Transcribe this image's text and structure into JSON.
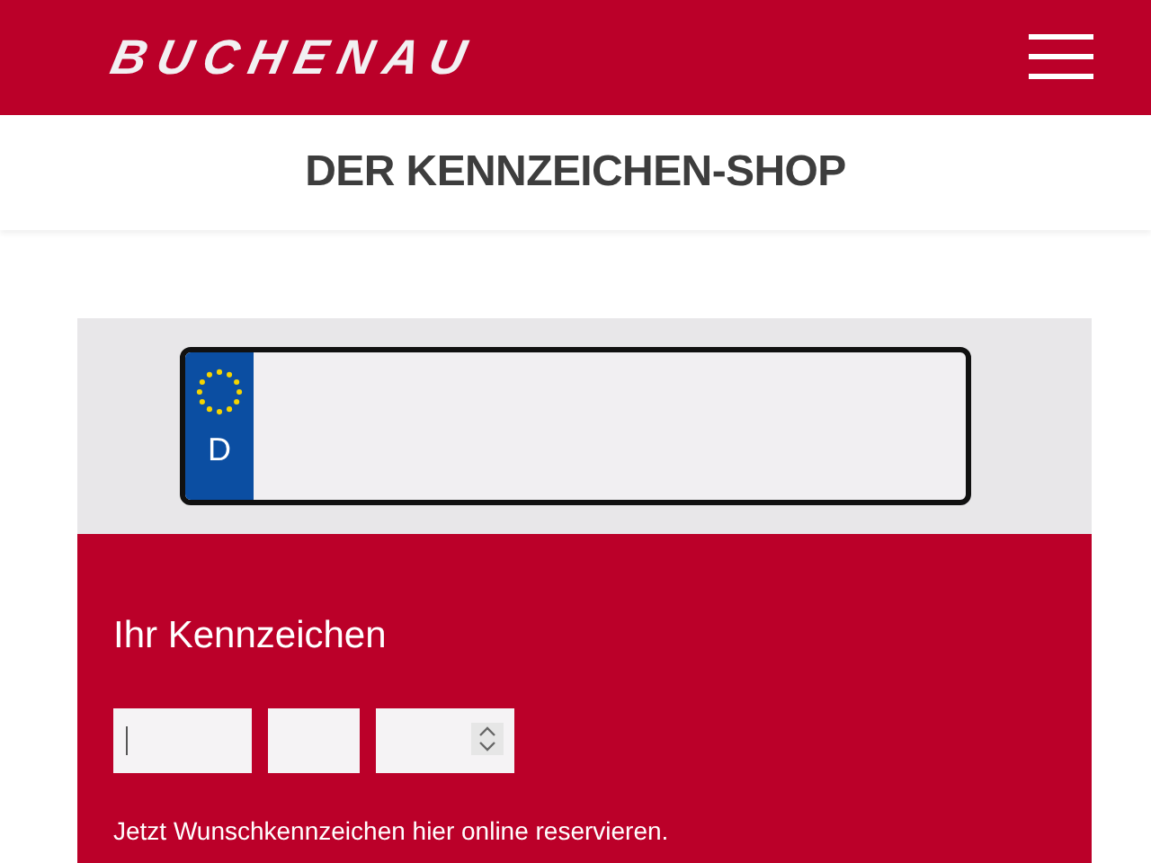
{
  "header": {
    "logo": "BUCHENAU"
  },
  "page_title": "DER KENNZEICHEN-SHOP",
  "plate": {
    "country": "D"
  },
  "form": {
    "heading": "Ihr Kennzeichen",
    "fields": [
      {
        "kind": "text",
        "focused": true
      },
      {
        "kind": "text",
        "focused": false
      },
      {
        "kind": "number",
        "focused": false
      }
    ],
    "note": "Jetzt Wunschkennzeichen hier online reservieren."
  }
}
